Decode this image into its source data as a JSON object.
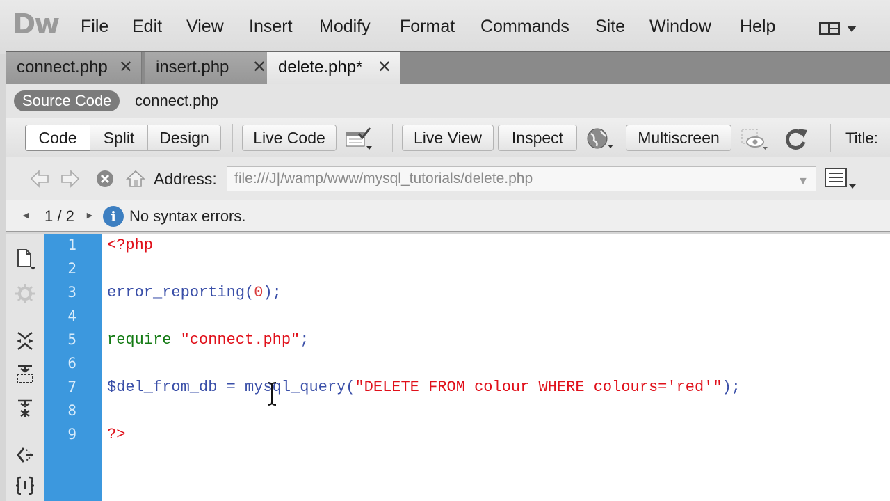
{
  "app": {
    "logo": "Dw"
  },
  "menu": [
    "File",
    "Edit",
    "View",
    "Insert",
    "Modify",
    "Format",
    "Commands",
    "Site",
    "Window",
    "Help"
  ],
  "tabs": [
    {
      "label": "connect.php",
      "active": false
    },
    {
      "label": "insert.php",
      "active": false
    },
    {
      "label": "delete.php*",
      "active": true
    }
  ],
  "related_files": {
    "source": "Source Code",
    "file": "connect.php"
  },
  "document_toolbar": {
    "code": "Code",
    "split": "Split",
    "design": "Design",
    "live_code": "Live Code",
    "live_view": "Live View",
    "inspect": "Inspect",
    "multiscreen": "Multiscreen",
    "title_label": "Title:"
  },
  "browser_nav": {
    "address_label": "Address:",
    "address_value": "file:///J|/wamp/www/mysql_tutorials/delete.php"
  },
  "status": {
    "count": "1 / 2",
    "message": "No syntax errors."
  },
  "editor": {
    "line_numbers": [
      "1",
      "2",
      "3",
      "4",
      "5",
      "6",
      "7",
      "8",
      "9"
    ],
    "lines": [
      [
        {
          "t": "<?php",
          "c": "red"
        }
      ],
      [],
      [
        {
          "t": "error_reporting(",
          "c": "blue"
        },
        {
          "t": "0",
          "c": "num"
        },
        {
          "t": ");",
          "c": "blue"
        }
      ],
      [],
      [
        {
          "t": "require ",
          "c": "green"
        },
        {
          "t": "\"connect.php\"",
          "c": "red"
        },
        {
          "t": ";",
          "c": "blue"
        }
      ],
      [],
      [
        {
          "t": "$del_from_db = mysql_query(",
          "c": "blue"
        },
        {
          "t": "\"DELETE FROM colour WHERE colours='red'\"",
          "c": "red"
        },
        {
          "t": ");",
          "c": "blue"
        }
      ],
      [],
      [
        {
          "t": "?>",
          "c": "red"
        }
      ]
    ]
  },
  "colors": {
    "gutter": "#3c98de",
    "php_tag": "#e0101a",
    "function": "#3a4fa8",
    "keyword": "#137a13"
  }
}
